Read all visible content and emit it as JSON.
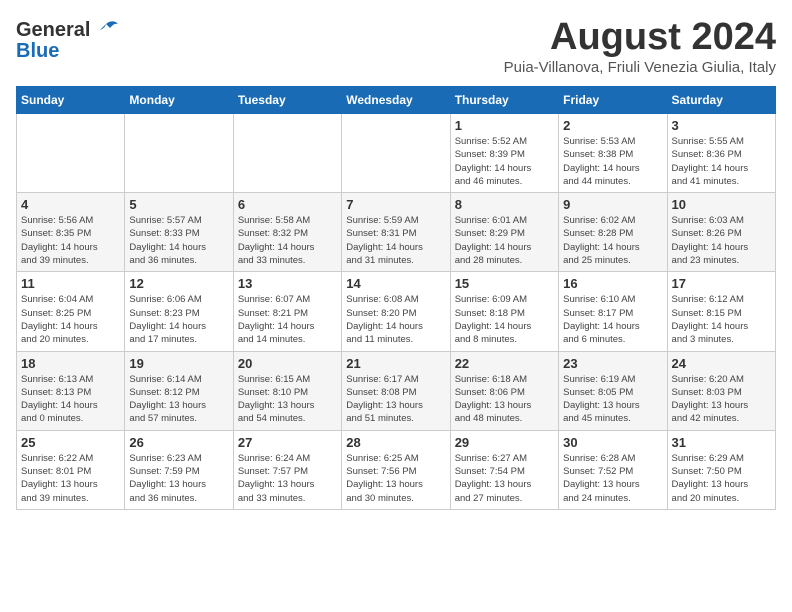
{
  "header": {
    "logo_line1": "General",
    "logo_line2": "Blue",
    "month": "August 2024",
    "location": "Puia-Villanova, Friuli Venezia Giulia, Italy"
  },
  "weekdays": [
    "Sunday",
    "Monday",
    "Tuesday",
    "Wednesday",
    "Thursday",
    "Friday",
    "Saturday"
  ],
  "weeks": [
    [
      {
        "day": "",
        "info": ""
      },
      {
        "day": "",
        "info": ""
      },
      {
        "day": "",
        "info": ""
      },
      {
        "day": "",
        "info": ""
      },
      {
        "day": "1",
        "info": "Sunrise: 5:52 AM\nSunset: 8:39 PM\nDaylight: 14 hours\nand 46 minutes."
      },
      {
        "day": "2",
        "info": "Sunrise: 5:53 AM\nSunset: 8:38 PM\nDaylight: 14 hours\nand 44 minutes."
      },
      {
        "day": "3",
        "info": "Sunrise: 5:55 AM\nSunset: 8:36 PM\nDaylight: 14 hours\nand 41 minutes."
      }
    ],
    [
      {
        "day": "4",
        "info": "Sunrise: 5:56 AM\nSunset: 8:35 PM\nDaylight: 14 hours\nand 39 minutes."
      },
      {
        "day": "5",
        "info": "Sunrise: 5:57 AM\nSunset: 8:33 PM\nDaylight: 14 hours\nand 36 minutes."
      },
      {
        "day": "6",
        "info": "Sunrise: 5:58 AM\nSunset: 8:32 PM\nDaylight: 14 hours\nand 33 minutes."
      },
      {
        "day": "7",
        "info": "Sunrise: 5:59 AM\nSunset: 8:31 PM\nDaylight: 14 hours\nand 31 minutes."
      },
      {
        "day": "8",
        "info": "Sunrise: 6:01 AM\nSunset: 8:29 PM\nDaylight: 14 hours\nand 28 minutes."
      },
      {
        "day": "9",
        "info": "Sunrise: 6:02 AM\nSunset: 8:28 PM\nDaylight: 14 hours\nand 25 minutes."
      },
      {
        "day": "10",
        "info": "Sunrise: 6:03 AM\nSunset: 8:26 PM\nDaylight: 14 hours\nand 23 minutes."
      }
    ],
    [
      {
        "day": "11",
        "info": "Sunrise: 6:04 AM\nSunset: 8:25 PM\nDaylight: 14 hours\nand 20 minutes."
      },
      {
        "day": "12",
        "info": "Sunrise: 6:06 AM\nSunset: 8:23 PM\nDaylight: 14 hours\nand 17 minutes."
      },
      {
        "day": "13",
        "info": "Sunrise: 6:07 AM\nSunset: 8:21 PM\nDaylight: 14 hours\nand 14 minutes."
      },
      {
        "day": "14",
        "info": "Sunrise: 6:08 AM\nSunset: 8:20 PM\nDaylight: 14 hours\nand 11 minutes."
      },
      {
        "day": "15",
        "info": "Sunrise: 6:09 AM\nSunset: 8:18 PM\nDaylight: 14 hours\nand 8 minutes."
      },
      {
        "day": "16",
        "info": "Sunrise: 6:10 AM\nSunset: 8:17 PM\nDaylight: 14 hours\nand 6 minutes."
      },
      {
        "day": "17",
        "info": "Sunrise: 6:12 AM\nSunset: 8:15 PM\nDaylight: 14 hours\nand 3 minutes."
      }
    ],
    [
      {
        "day": "18",
        "info": "Sunrise: 6:13 AM\nSunset: 8:13 PM\nDaylight: 14 hours\nand 0 minutes."
      },
      {
        "day": "19",
        "info": "Sunrise: 6:14 AM\nSunset: 8:12 PM\nDaylight: 13 hours\nand 57 minutes."
      },
      {
        "day": "20",
        "info": "Sunrise: 6:15 AM\nSunset: 8:10 PM\nDaylight: 13 hours\nand 54 minutes."
      },
      {
        "day": "21",
        "info": "Sunrise: 6:17 AM\nSunset: 8:08 PM\nDaylight: 13 hours\nand 51 minutes."
      },
      {
        "day": "22",
        "info": "Sunrise: 6:18 AM\nSunset: 8:06 PM\nDaylight: 13 hours\nand 48 minutes."
      },
      {
        "day": "23",
        "info": "Sunrise: 6:19 AM\nSunset: 8:05 PM\nDaylight: 13 hours\nand 45 minutes."
      },
      {
        "day": "24",
        "info": "Sunrise: 6:20 AM\nSunset: 8:03 PM\nDaylight: 13 hours\nand 42 minutes."
      }
    ],
    [
      {
        "day": "25",
        "info": "Sunrise: 6:22 AM\nSunset: 8:01 PM\nDaylight: 13 hours\nand 39 minutes."
      },
      {
        "day": "26",
        "info": "Sunrise: 6:23 AM\nSunset: 7:59 PM\nDaylight: 13 hours\nand 36 minutes."
      },
      {
        "day": "27",
        "info": "Sunrise: 6:24 AM\nSunset: 7:57 PM\nDaylight: 13 hours\nand 33 minutes."
      },
      {
        "day": "28",
        "info": "Sunrise: 6:25 AM\nSunset: 7:56 PM\nDaylight: 13 hours\nand 30 minutes."
      },
      {
        "day": "29",
        "info": "Sunrise: 6:27 AM\nSunset: 7:54 PM\nDaylight: 13 hours\nand 27 minutes."
      },
      {
        "day": "30",
        "info": "Sunrise: 6:28 AM\nSunset: 7:52 PM\nDaylight: 13 hours\nand 24 minutes."
      },
      {
        "day": "31",
        "info": "Sunrise: 6:29 AM\nSunset: 7:50 PM\nDaylight: 13 hours\nand 20 minutes."
      }
    ]
  ]
}
